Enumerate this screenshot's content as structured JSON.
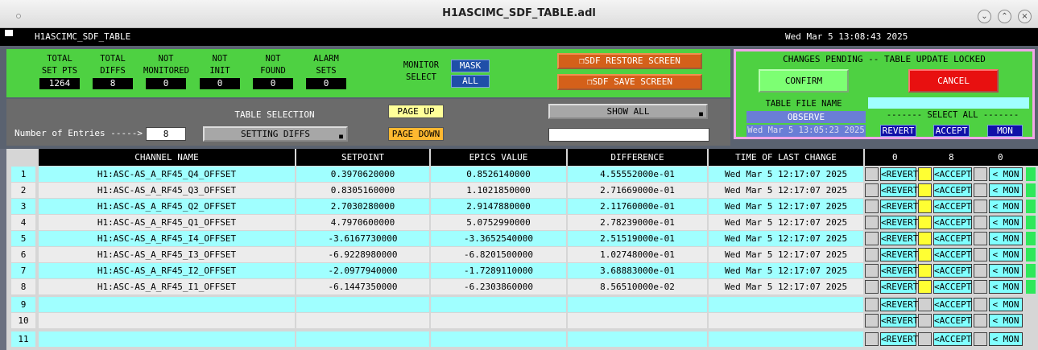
{
  "window": {
    "title": "H1ASCIMC_SDF_TABLE.adl"
  },
  "header": {
    "screen_name": "H1ASCIMC_SDF_TABLE",
    "datetime": "Wed Mar  5 13:08:43 2025"
  },
  "stats": [
    {
      "l1": "TOTAL",
      "l2": "SET PTS",
      "value": "1264"
    },
    {
      "l1": "TOTAL",
      "l2": "DIFFS",
      "value": "8"
    },
    {
      "l1": "NOT",
      "l2": "MONITORED",
      "value": "0"
    },
    {
      "l1": "NOT",
      "l2": "INIT",
      "value": "0"
    },
    {
      "l1": "NOT",
      "l2": "FOUND",
      "value": "0"
    },
    {
      "l1": "ALARM",
      "l2": "SETS",
      "value": "0"
    }
  ],
  "monitor": {
    "l1": "MONITOR",
    "l2": "SELECT",
    "mask": "MASK",
    "all": "ALL"
  },
  "actions": {
    "restore": "SDF RESTORE SCREEN",
    "save": "SDF SAVE SCREEN"
  },
  "pending": {
    "msg": "CHANGES PENDING -- TABLE UPDATE LOCKED",
    "confirm": "CONFIRM",
    "cancel": "CANCEL",
    "file_label": "TABLE FILE NAME",
    "file_value": "OBSERVE",
    "file_time": "Wed Mar  5 13:05:23 2025",
    "select_all": "------- SELECT ALL -------",
    "revert": "REVERT",
    "accept": "ACCEPT",
    "mon": "MON"
  },
  "selection": {
    "entries_label": "Number of Entries ----->",
    "entries_value": "8",
    "table_label": "TABLE SELECTION",
    "table_value": "SETTING DIFFS",
    "page_up": "PAGE UP",
    "page_down": "PAGE DOWN",
    "show": "SHOW ALL",
    "filter": ""
  },
  "columns": {
    "channel": "CHANNEL NAME",
    "setpoint": "SETPOINT",
    "epics": "EPICS VALUE",
    "diff": "DIFFERENCE",
    "time": "TIME OF LAST CHANGE",
    "c1": "0",
    "c2": "8",
    "c3": "0"
  },
  "row_buttons": {
    "revert": "<REVERT",
    "accept": "<ACCEPT",
    "mon": "< MON"
  },
  "rows": [
    {
      "n": "1",
      "ch": "H1:ASC-AS_A_RF45_Q4_OFFSET",
      "sp": "0.3970620000",
      "ev": "0.8526140000",
      "df": "4.55552000e-01",
      "tm": "Wed Mar  5 12:17:07 2025"
    },
    {
      "n": "2",
      "ch": "H1:ASC-AS_A_RF45_Q3_OFFSET",
      "sp": "0.8305160000",
      "ev": "1.1021850000",
      "df": "2.71669000e-01",
      "tm": "Wed Mar  5 12:17:07 2025"
    },
    {
      "n": "3",
      "ch": "H1:ASC-AS_A_RF45_Q2_OFFSET",
      "sp": "2.7030280000",
      "ev": "2.9147880000",
      "df": "2.11760000e-01",
      "tm": "Wed Mar  5 12:17:07 2025"
    },
    {
      "n": "4",
      "ch": "H1:ASC-AS_A_RF45_Q1_OFFSET",
      "sp": "4.7970600000",
      "ev": "5.0752990000",
      "df": "2.78239000e-01",
      "tm": "Wed Mar  5 12:17:07 2025"
    },
    {
      "n": "5",
      "ch": "H1:ASC-AS_A_RF45_I4_OFFSET",
      "sp": "-3.6167730000",
      "ev": "-3.3652540000",
      "df": "2.51519000e-01",
      "tm": "Wed Mar  5 12:17:07 2025"
    },
    {
      "n": "6",
      "ch": "H1:ASC-AS_A_RF45_I3_OFFSET",
      "sp": "-6.9228980000",
      "ev": "-6.8201500000",
      "df": "1.02748000e-01",
      "tm": "Wed Mar  5 12:17:07 2025"
    },
    {
      "n": "7",
      "ch": "H1:ASC-AS_A_RF45_I2_OFFSET",
      "sp": "-2.0977940000",
      "ev": "-1.7289110000",
      "df": "3.68883000e-01",
      "tm": "Wed Mar  5 12:17:07 2025"
    },
    {
      "n": "8",
      "ch": "H1:ASC-AS_A_RF45_I1_OFFSET",
      "sp": "-6.1447350000",
      "ev": "-6.2303860000",
      "df": "8.56510000e-02",
      "tm": "Wed Mar  5 12:17:07 2025"
    },
    {
      "n": "9",
      "ch": "",
      "sp": "",
      "ev": "",
      "df": "",
      "tm": ""
    },
    {
      "n": "10",
      "ch": "",
      "sp": "",
      "ev": "",
      "df": "",
      "tm": ""
    },
    {
      "n": "11",
      "ch": "",
      "sp": "",
      "ev": "",
      "df": "",
      "tm": ""
    }
  ],
  "colors": {
    "cyan": "#a0ffff",
    "light": "#ececec",
    "yellow": "#ffff33",
    "green_pane": "#4ed142",
    "accent_green": "#2ee85a"
  }
}
